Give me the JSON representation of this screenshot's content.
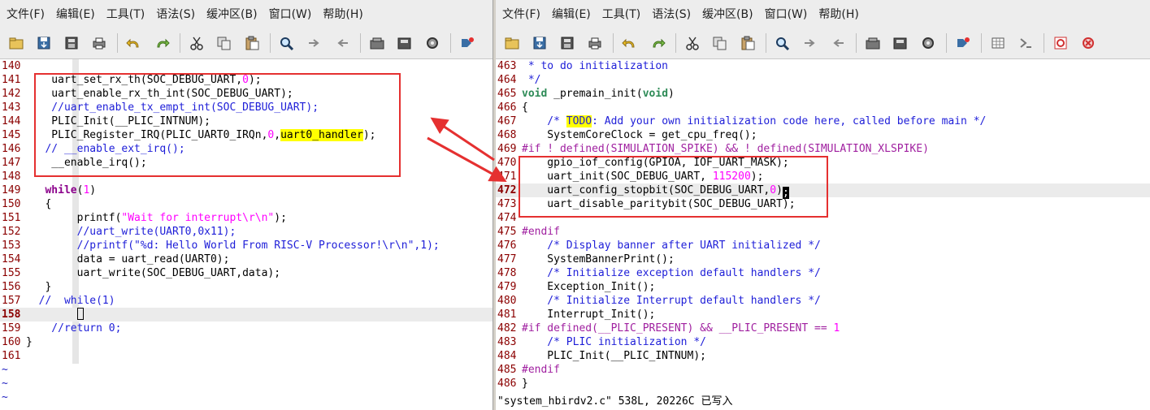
{
  "menus": [
    "文件(F)",
    "编辑(E)",
    "工具(T)",
    "语法(S)",
    "缓冲区(B)",
    "窗口(W)",
    "帮助(H)"
  ],
  "toolbar_icons": {
    "left": [
      "open-file-icon",
      "save-icon",
      "save-all-icon",
      "print-icon",
      "undo-icon",
      "redo-icon",
      "cut-icon",
      "copy-icon",
      "paste-icon",
      "find-replace-icon",
      "find-next-icon",
      "find-previous-icon",
      "load-session-icon",
      "save-session-icon",
      "run-script-icon",
      "tags-jump-icon"
    ],
    "right": [
      "open-file-icon",
      "save-icon",
      "save-all-icon",
      "print-icon",
      "undo-icon",
      "redo-icon",
      "cut-icon",
      "copy-icon",
      "paste-icon",
      "find-replace-icon",
      "find-next-icon",
      "find-previous-icon",
      "load-session-icon",
      "save-session-icon",
      "run-script-icon",
      "tags-jump-icon",
      "make-icon",
      "shell-icon",
      "help-icon",
      "find-help-icon"
    ]
  },
  "left_editor": {
    "lines": [
      {
        "n": "140",
        "t": [
          [
            "",
            ""
          ]
        ]
      },
      {
        "n": "141",
        "t": [
          [
            "",
            "    uart_set_rx_th(SOC_DEBUG_UART,"
          ],
          [
            "num",
            "0"
          ],
          [
            "",
            ");"
          ]
        ]
      },
      {
        "n": "142",
        "t": [
          [
            "",
            "    uart_enable_rx_th_int(SOC_DEBUG_UART);"
          ]
        ]
      },
      {
        "n": "143",
        "t": [
          [
            "cmt",
            "    //uart_enable_tx_empt_int(SOC_DEBUG_UART);"
          ]
        ]
      },
      {
        "n": "144",
        "t": [
          [
            "",
            "    PLIC_Init(__PLIC_INTNUM);"
          ]
        ]
      },
      {
        "n": "145",
        "t": [
          [
            "",
            "    PLIC_Register_IRQ(PLIC_UART0_IRQn,"
          ],
          [
            "num",
            "0"
          ],
          [
            "",
            ","
          ],
          [
            "hl",
            "uart0_handler"
          ],
          [
            "",
            ");"
          ]
        ]
      },
      {
        "n": "146",
        "t": [
          [
            "cmt",
            "   // __enable_ext_irq();"
          ]
        ]
      },
      {
        "n": "147",
        "t": [
          [
            "",
            "    __enable_irq();"
          ]
        ]
      },
      {
        "n": "148",
        "t": [
          [
            "",
            ""
          ]
        ]
      },
      {
        "n": "149",
        "t": [
          [
            "",
            "   "
          ],
          [
            "kw",
            "while"
          ],
          [
            "",
            "("
          ],
          [
            "num",
            "1"
          ],
          [
            "",
            ")"
          ]
        ]
      },
      {
        "n": "150",
        "t": [
          [
            "",
            "   {"
          ]
        ]
      },
      {
        "n": "151",
        "t": [
          [
            "",
            "        printf("
          ],
          [
            "str",
            "\"Wait for interrupt\\r\\n\""
          ],
          [
            "",
            ");"
          ]
        ]
      },
      {
        "n": "152",
        "t": [
          [
            "cmt",
            "        //uart_write(UART0,0x11);"
          ]
        ]
      },
      {
        "n": "153",
        "t": [
          [
            "cmt",
            "        //printf(\"%d: Hello World From RISC-V Processor!\\r\\n\",1);"
          ]
        ]
      },
      {
        "n": "154",
        "t": [
          [
            "",
            "        data = uart_read(UART0);"
          ]
        ]
      },
      {
        "n": "155",
        "t": [
          [
            "",
            "        uart_write(SOC_DEBUG_UART,data);"
          ]
        ]
      },
      {
        "n": "156",
        "t": [
          [
            "",
            "   }"
          ]
        ]
      },
      {
        "n": "157",
        "t": [
          [
            "cmt",
            "  //  while(1)"
          ]
        ]
      },
      {
        "n": "158",
        "t": [
          [
            "",
            "        "
          ],
          [
            "caret-outline",
            ""
          ]
        ],
        "cursorline": true
      },
      {
        "n": "159",
        "t": [
          [
            "cmt",
            "    //return 0;"
          ]
        ]
      },
      {
        "n": "160",
        "t": [
          [
            "",
            "}"
          ]
        ]
      },
      {
        "n": "161",
        "t": [
          [
            "",
            ""
          ]
        ]
      }
    ],
    "tildes": [
      "~",
      "~",
      "~"
    ]
  },
  "right_editor": {
    "lines": [
      {
        "n": "463",
        "t": [
          [
            "cmt",
            " * to do initialization"
          ]
        ]
      },
      {
        "n": "464",
        "t": [
          [
            "cmt",
            " */"
          ]
        ]
      },
      {
        "n": "465",
        "t": [
          [
            "type",
            "void"
          ],
          [
            "",
            " _premain_init("
          ],
          [
            "type",
            "void"
          ],
          [
            "",
            ")"
          ]
        ]
      },
      {
        "n": "466",
        "t": [
          [
            "",
            "{"
          ]
        ]
      },
      {
        "n": "467",
        "t": [
          [
            "cmt",
            "    /* "
          ],
          [
            "todo",
            "TODO"
          ],
          [
            "cmt",
            ": Add your own initialization code here, called before main */"
          ]
        ]
      },
      {
        "n": "468",
        "t": [
          [
            "",
            "    SystemCoreClock = get_cpu_freq();"
          ]
        ]
      },
      {
        "n": "469",
        "t": [
          [
            "pre",
            "#if ! defined(SIMULATION_SPIKE) && ! defined(SIMULATION_XLSPIKE)"
          ]
        ]
      },
      {
        "n": "470",
        "t": [
          [
            "",
            "    gpio_iof_config(GPIOA, IOF_UART_MASK);"
          ]
        ]
      },
      {
        "n": "471",
        "t": [
          [
            "",
            "    uart_init(SOC_DEBUG_UART, "
          ],
          [
            "num",
            "115200"
          ],
          [
            "",
            ");"
          ]
        ]
      },
      {
        "n": "472",
        "t": [
          [
            "",
            "    uart_config_stopbit(SOC_DEBUG_UART,"
          ],
          [
            "num",
            "0"
          ],
          [
            "",
            ")"
          ],
          [
            "caret-block",
            ";"
          ]
        ],
        "cursorline": true
      },
      {
        "n": "473",
        "t": [
          [
            "",
            "    uart_disable_paritybit(SOC_DEBUG_UART);"
          ]
        ]
      },
      {
        "n": "474",
        "t": [
          [
            "",
            ""
          ]
        ]
      },
      {
        "n": "475",
        "t": [
          [
            "pre",
            "#endif"
          ]
        ]
      },
      {
        "n": "476",
        "t": [
          [
            "cmt",
            "    /* Display banner after UART initialized */"
          ]
        ]
      },
      {
        "n": "477",
        "t": [
          [
            "",
            "    SystemBannerPrint();"
          ]
        ]
      },
      {
        "n": "478",
        "t": [
          [
            "cmt",
            "    /* Initialize exception default handlers */"
          ]
        ]
      },
      {
        "n": "479",
        "t": [
          [
            "",
            "    Exception_Init();"
          ]
        ]
      },
      {
        "n": "480",
        "t": [
          [
            "cmt",
            "    /* Initialize Interrupt default handlers */"
          ]
        ]
      },
      {
        "n": "481",
        "t": [
          [
            "",
            "    Interrupt_Init();"
          ]
        ]
      },
      {
        "n": "482",
        "t": [
          [
            "pre",
            "#if defined(__PLIC_PRESENT) && __PLIC_PRESENT == "
          ],
          [
            "num",
            "1"
          ]
        ]
      },
      {
        "n": "483",
        "t": [
          [
            "cmt",
            "    /* PLIC initialization */"
          ]
        ]
      },
      {
        "n": "484",
        "t": [
          [
            "",
            "    PLIC_Init(__PLIC_INTNUM);"
          ]
        ]
      },
      {
        "n": "485",
        "t": [
          [
            "pre",
            "#endif"
          ]
        ]
      },
      {
        "n": "486",
        "t": [
          [
            "",
            "}"
          ]
        ]
      }
    ],
    "status": "\"system_hbirdv2.c\" 538L, 20226C 已写入"
  },
  "colors": {
    "annotation_red": "#e53030",
    "line_number": "#8b0000",
    "comment": "#1e1ed8",
    "string_number": "#ff00ff",
    "keyword": "#8b008b",
    "type": "#2e8b57",
    "highlight": "#ffff00"
  }
}
